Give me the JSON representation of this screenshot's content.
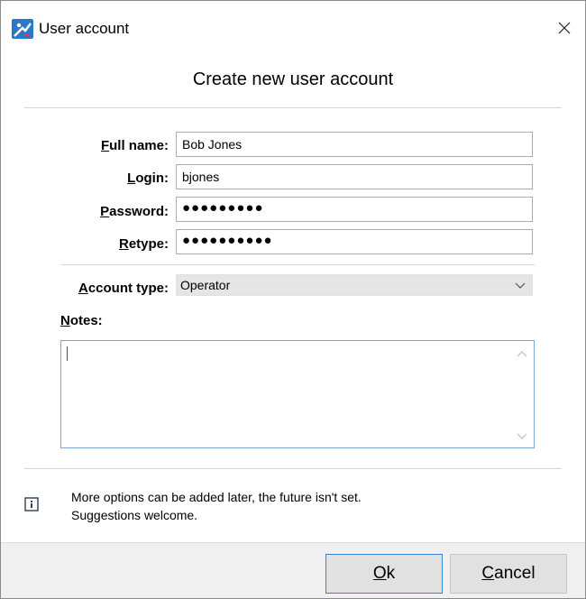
{
  "window": {
    "title": "User account"
  },
  "heading": "Create new user account",
  "form": {
    "full_name": {
      "label_first": "F",
      "label_rest": "ull name:",
      "value": "Bob Jones"
    },
    "login": {
      "label_first": "L",
      "label_rest": "ogin:",
      "value": "bjones"
    },
    "password": {
      "label_first": "P",
      "label_rest": "assword:",
      "value": "●●●●●●●●●"
    },
    "retype": {
      "label_first": "R",
      "label_rest": "etype:",
      "value": "●●●●●●●●●●"
    },
    "account_type": {
      "label_first": "A",
      "label_rest": "ccount type:",
      "value": "Operator"
    },
    "notes": {
      "label_first": "N",
      "label_rest": "otes:",
      "value": ""
    }
  },
  "info": {
    "line1": "More options can be added later, the future isn't set.",
    "line2": "Suggestions welcome."
  },
  "buttons": {
    "ok_first": "O",
    "ok_rest": "k",
    "cancel_first": "C",
    "cancel_rest": "ancel"
  },
  "colors": {
    "focus_border": "#3c7fd6",
    "notes_border": "#7ea4d6"
  }
}
